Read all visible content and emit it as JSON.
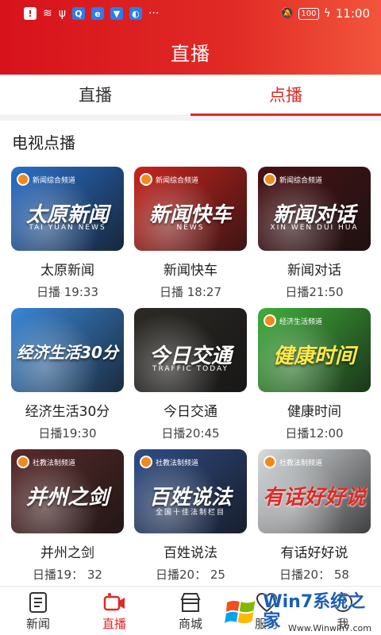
{
  "status_bar": {
    "icons": [
      "alert-icon",
      "wifi-icon",
      "usb-icon",
      "app-q-icon",
      "app-e-icon",
      "app-download-icon",
      "app-bulb-icon",
      "more-icon"
    ],
    "right_icons": [
      "mute-icon",
      "battery-icon",
      "charging-icon"
    ],
    "battery": "100",
    "time": "11:00"
  },
  "header": {
    "title": "直播"
  },
  "tabs": [
    {
      "label": "直播",
      "active": false
    },
    {
      "label": "点播",
      "active": true
    }
  ],
  "section": {
    "title": "电视点播"
  },
  "programs": [
    {
      "title": "太原新闻",
      "time": "日播 19:33",
      "channel": "新闻综合频道",
      "art": "太原新闻",
      "sub": "TAI YUAN NEWS"
    },
    {
      "title": "新闻快车",
      "time": "日播 18:27",
      "channel": "新闻综合频道",
      "art": "新闻快车",
      "sub": "NEWS"
    },
    {
      "title": "新闻对话",
      "time": "日播21:50",
      "channel": "新闻综合频道",
      "art": "新闻对话",
      "sub": "XIN WEN DUI HUA"
    },
    {
      "title": "经济生活30分",
      "time": "日播19:30",
      "channel": "",
      "art": "经济生活30分",
      "sub": ""
    },
    {
      "title": "今日交通",
      "time": "日播20:45",
      "channel": "",
      "art": "今日交通",
      "sub": "TRAFFIC TODAY"
    },
    {
      "title": "健康时间",
      "time": "日播12:00",
      "channel": "经济生活频道",
      "art": "健康时间",
      "sub": ""
    },
    {
      "title": "并州之剑",
      "time": "日播19： 32",
      "channel": "社教法制频道",
      "art": "并州之剑",
      "sub": ""
    },
    {
      "title": "百姓说法",
      "time": "日播20： 25",
      "channel": "社教法制频道",
      "art": "百姓说法",
      "sub": "全国十佳法制栏目"
    },
    {
      "title": "有话好好说",
      "time": "日播20： 58",
      "channel": "社教法制频道",
      "art": "有话好好说",
      "sub": ""
    }
  ],
  "thumb_colors": [
    "#2a6fc9",
    "#c8231d",
    "#4a1216",
    "#3a86d6",
    "#2d2a26",
    "#3fae3a",
    "#5a2a2a",
    "#2f4c86",
    "#d9dde0"
  ],
  "bottom_nav": [
    {
      "label": "新闻",
      "icon": "news-icon",
      "active": false
    },
    {
      "label": "直播",
      "icon": "live-camera-icon",
      "active": true
    },
    {
      "label": "商城",
      "icon": "store-icon",
      "active": false
    },
    {
      "label": "服务",
      "icon": "heart-icon",
      "active": false
    },
    {
      "label": "我",
      "icon": "profile-icon",
      "active": false
    }
  ],
  "watermark": {
    "text": "Win7系统之家",
    "url": "Www.Winwin7.com"
  },
  "colors": {
    "accent": "#e02a25",
    "header_start": "#d7121b",
    "header_end": "#f2553c"
  }
}
